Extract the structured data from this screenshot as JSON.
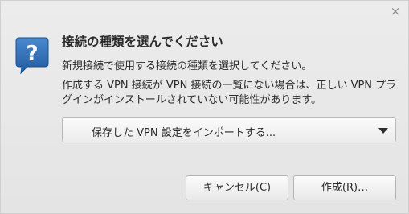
{
  "dialog": {
    "close_glyph": "×",
    "icon": "question-icon",
    "title": "接続の種類を選んでください",
    "subtitle": "新規接続で使用する接続の種類を選択してください。",
    "info_lines": [
      "作成する VPN 接続が VPN 接続の一覧にない場合は、正しい VPN プラ",
      "グインがインストールされていない可能性があります。"
    ],
    "connection_type": {
      "selected": "保存した VPN 設定をインポートする..."
    },
    "buttons": {
      "cancel": "キャンセル(C)",
      "create": "作成(R)…"
    }
  },
  "colors": {
    "icon_blue": "#2f6fb5",
    "background": "#e8e8e8"
  }
}
